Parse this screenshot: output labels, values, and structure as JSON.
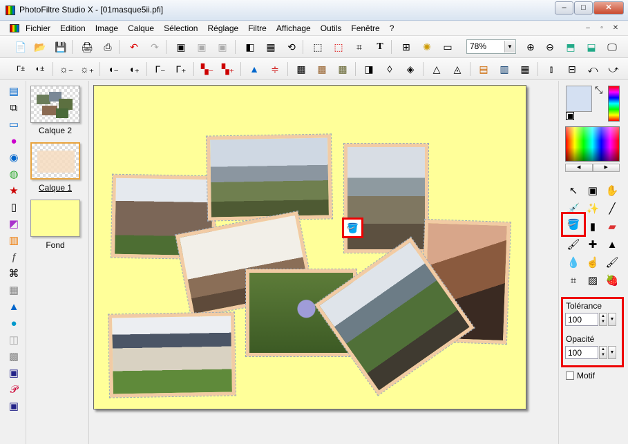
{
  "window": {
    "title": "PhotoFiltre Studio X - [01masque5ii.pfi]",
    "minimize": "–",
    "maximize": "□",
    "close": "✕"
  },
  "menu": {
    "items": [
      "Fichier",
      "Edition",
      "Image",
      "Calque",
      "Sélection",
      "Réglage",
      "Filtre",
      "Affichage",
      "Outils",
      "Fenêtre",
      "?"
    ],
    "mdi": [
      "–",
      "▫",
      "✕"
    ]
  },
  "toolbar": {
    "zoom_value": "78%",
    "text_tool": "T"
  },
  "layers": {
    "items": [
      "Calque 2",
      "Calque 1",
      "Fond"
    ]
  },
  "options": {
    "tolerance_label": "Tolérance",
    "tolerance_value": "100",
    "opacity_label": "Opacité",
    "opacity_value": "100",
    "motif_label": "Motif"
  },
  "colors": {
    "canvas_bg": "#ffff99",
    "foreground": "#d4e0f2",
    "frame": "#f2cba4",
    "highlight": "#ee0000",
    "layer_selected": "#e8a33d"
  }
}
